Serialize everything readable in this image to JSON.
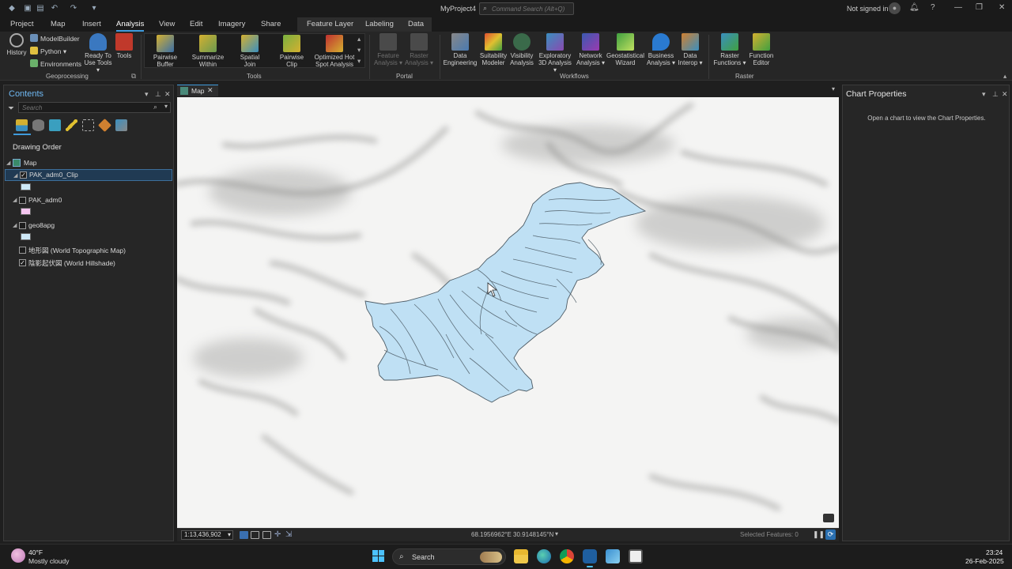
{
  "window": {
    "title": "MyProject4",
    "command_search_placeholder": "Command Search (Alt+Q)",
    "signed_in_status": "Not signed in"
  },
  "ribbon": {
    "tabs": [
      "Project",
      "Map",
      "Insert",
      "Analysis",
      "View",
      "Edit",
      "Imagery",
      "Share"
    ],
    "active_tab": "Analysis",
    "contextual_tabs": [
      "Feature Layer",
      "Labeling",
      "Data"
    ],
    "geoprocessing": {
      "history": "History",
      "modelbuilder": "ModelBuilder",
      "python": "Python",
      "environments": "Environments",
      "ready_to_use_1": "Ready To",
      "ready_to_use_2": "Use Tools",
      "tools": "Tools",
      "label": "Geoprocessing"
    },
    "tools_group": {
      "label": "Tools",
      "items": [
        {
          "line1": "Pairwise",
          "line2": "Buffer"
        },
        {
          "line1": "Summarize",
          "line2": "Within"
        },
        {
          "line1": "Spatial",
          "line2": "Join"
        },
        {
          "line1": "Pairwise",
          "line2": "Clip"
        },
        {
          "line1": "Optimized Hot",
          "line2": "Spot Analysis"
        }
      ]
    },
    "portal_group": {
      "label": "Portal",
      "items": [
        {
          "line1": "Feature",
          "line2": "Analysis"
        },
        {
          "line1": "Raster",
          "line2": "Analysis"
        }
      ]
    },
    "workflows_group": {
      "label": "Workflows",
      "items": [
        {
          "line1": "Data",
          "line2": "Engineering"
        },
        {
          "line1": "Suitability",
          "line2": "Modeler"
        },
        {
          "line1": "Visibility",
          "line2": "Analysis"
        },
        {
          "line1": "Exploratory",
          "line2": "3D Analysis"
        },
        {
          "line1": "Network",
          "line2": "Analysis"
        },
        {
          "line1": "Geostatistical",
          "line2": "Wizard"
        },
        {
          "line1": "Business",
          "line2": "Analysis"
        },
        {
          "line1": "Data",
          "line2": "Interop"
        }
      ]
    },
    "raster_group": {
      "label": "Raster",
      "items": [
        {
          "line1": "Raster",
          "line2": "Functions"
        },
        {
          "line1": "Function",
          "line2": "Editor"
        }
      ]
    }
  },
  "contents": {
    "title": "Contents",
    "search_placeholder": "Search",
    "drawing_order": "Drawing Order",
    "layers": [
      {
        "name": "Map",
        "checked": true,
        "swatch": ""
      },
      {
        "name": "PAK_adm0_Clip",
        "checked": true,
        "swatch": "#cde8f7",
        "selected": true
      },
      {
        "name": "PAK_adm0",
        "checked": false,
        "swatch": "#f5c6f0"
      },
      {
        "name": "geo8apg",
        "checked": false,
        "swatch": "#cde8f7"
      },
      {
        "name": "地形図 (World Topographic Map)",
        "checked": false,
        "swatch": ""
      },
      {
        "name": "陰影起伏図 (World Hillshade)",
        "checked": true,
        "swatch": ""
      }
    ]
  },
  "map_view": {
    "tab_label": "Map",
    "scale": "1:13,436,902",
    "coordinates": "68.1956962°E 30.9148145°N",
    "selected_features": "Selected Features: 0"
  },
  "chart_properties": {
    "title": "Chart Properties",
    "message": "Open a chart to view the Chart Properties."
  },
  "taskbar": {
    "weather_temp": "40°F",
    "weather_desc": "Mostly cloudy",
    "search_label": "Search",
    "time": "23:24",
    "date": "26-Feb-2025"
  },
  "colors": {
    "accent": "#3f9bdc",
    "polygon_fill": "#bfe0f4",
    "polygon_stroke": "#4d5c66",
    "map_background": "#f4f4f3"
  }
}
